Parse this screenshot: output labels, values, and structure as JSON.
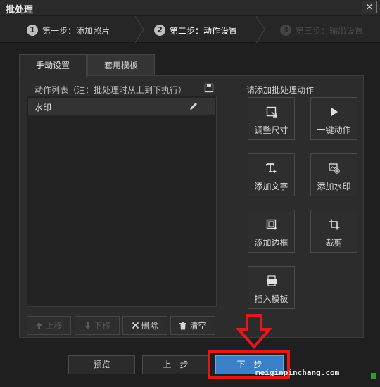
{
  "window": {
    "title": "批处理",
    "close_symbol": "×"
  },
  "steps": [
    {
      "num": "1",
      "label": "第一步：添加照片"
    },
    {
      "num": "2",
      "label": "第二步：动作设置"
    },
    {
      "num": "3",
      "label": "第三步：输出设置"
    }
  ],
  "tabs": {
    "manual": "手动设置",
    "template": "套用模板"
  },
  "action_list": {
    "header": "动作列表（注：批处理时从上到下执行）",
    "items": [
      {
        "label": "水印"
      }
    ]
  },
  "list_buttons": {
    "up": "上移",
    "down": "下移",
    "delete": "删除",
    "clear": "清空"
  },
  "add_actions": {
    "header": "请添加批处理动作",
    "resize": "调整尺寸",
    "one_click": "一键动作",
    "add_text": "添加文字",
    "add_watermark": "添加水印",
    "add_border": "添加边框",
    "crop": "裁剪",
    "insert_template": "插入模板"
  },
  "footer": {
    "preview": "预览",
    "prev": "上一步",
    "next": "下一步"
  },
  "watermark_text": "meiginpinchang.com",
  "colors": {
    "accent": "#3a7fc8",
    "highlight": "#e01a1a",
    "background": "#1f1f1f"
  }
}
